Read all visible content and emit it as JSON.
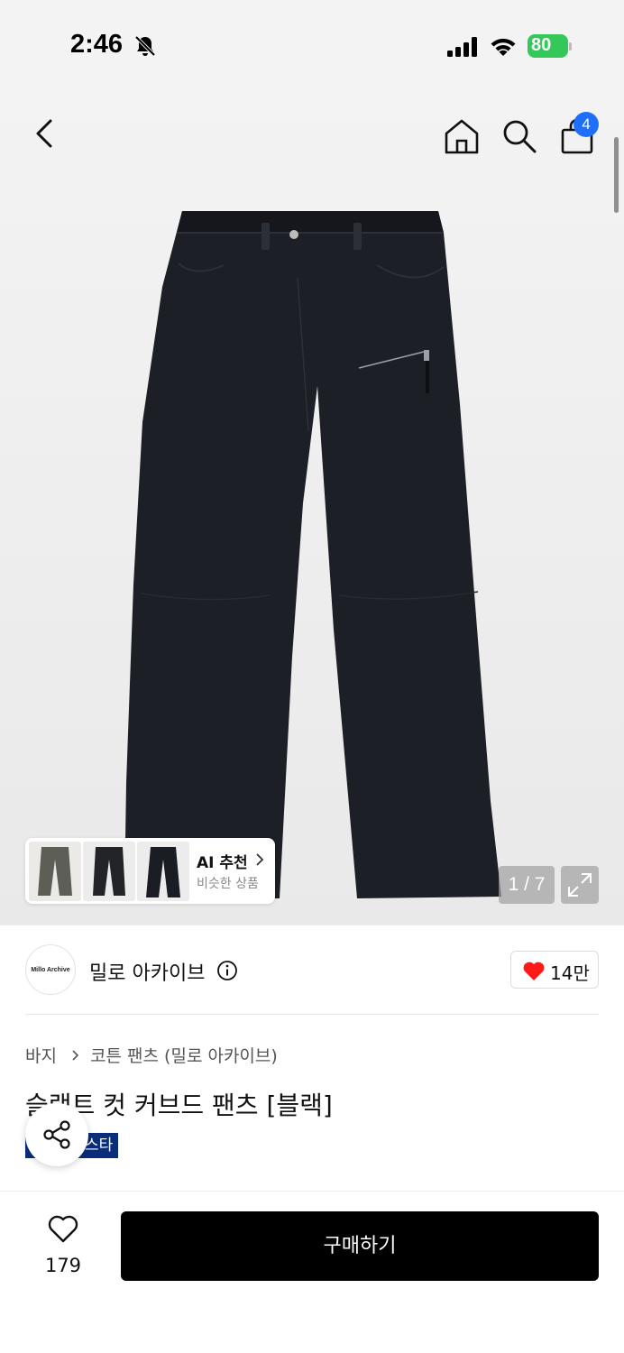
{
  "status_bar": {
    "time": "2:46",
    "battery": "80"
  },
  "header": {
    "cart_count": "4"
  },
  "gallery": {
    "counter": "1 / 7",
    "ai_card": {
      "title": "AI 추천",
      "subtitle": "비슷한 상품"
    }
  },
  "brand": {
    "logo_text": "Millo Archive",
    "name": "밀로 아카이브",
    "likes": "14만"
  },
  "breadcrumb": {
    "category": "바지",
    "subcategory": "코튼 팬츠 (밀로 아카이브)"
  },
  "product": {
    "title": "슬랙트 컷 커브드 팬츠 [블랙]",
    "badge": "스타"
  },
  "bottom_bar": {
    "wish_count": "179",
    "buy_label": "구매하기"
  },
  "colors": {
    "badge_blue": "#0a2d7a",
    "cart_badge": "#1f6fff",
    "heart_red": "#ff1a1a",
    "battery_green": "#34c759"
  },
  "icons": [
    "back-icon",
    "home-icon",
    "search-icon",
    "cart-icon",
    "info-icon",
    "heart-icon",
    "share-icon",
    "expand-icon"
  ]
}
